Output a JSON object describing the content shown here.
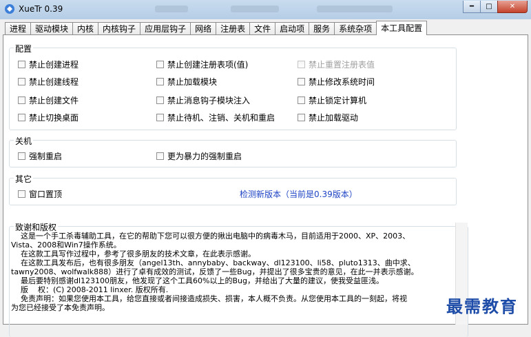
{
  "window": {
    "title": "XueTr 0.39"
  },
  "tabs": [
    "进程",
    "驱动模块",
    "内核",
    "内核钩子",
    "应用层钩子",
    "网络",
    "注册表",
    "文件",
    "启动项",
    "服务",
    "系统杂项",
    "本工具配置"
  ],
  "active_tab": 11,
  "config": {
    "label": "配置",
    "options": [
      {
        "label": "禁止创建进程",
        "enabled": true
      },
      {
        "label": "禁止创建注册表项(值)",
        "enabled": true
      },
      {
        "label": "禁止重置注册表值",
        "enabled": false
      },
      {
        "label": "禁止创建线程",
        "enabled": true
      },
      {
        "label": "禁止加载模块",
        "enabled": true
      },
      {
        "label": "禁止修改系统时间",
        "enabled": true
      },
      {
        "label": "禁止创建文件",
        "enabled": true
      },
      {
        "label": "禁止消息钩子模块注入",
        "enabled": true
      },
      {
        "label": "禁止锁定计算机",
        "enabled": true
      },
      {
        "label": "禁止切换桌面",
        "enabled": true
      },
      {
        "label": "禁止待机、注销、关机和重启",
        "enabled": true
      },
      {
        "label": "禁止加载驱动",
        "enabled": true
      }
    ]
  },
  "shutdown": {
    "label": "关机",
    "options": [
      {
        "label": "强制重启"
      },
      {
        "label": "更为暴力的强制重启"
      }
    ]
  },
  "other": {
    "label": "其它",
    "options": [
      {
        "label": "窗口置顶"
      }
    ],
    "check_update": "检测新版本（当前是0.39版本）"
  },
  "about": {
    "label": "致谢和版权",
    "lines": [
      "    这是一个手工杀毒辅助工具，在它的帮助下您可以很方便的揪出电脑中的病毒木马，目前适用于2000、XP、2003、",
      "Vista、2008和Win7操作系统。",
      "    在这款工具写作过程中，参考了很多朋友的技术文章，在此表示感谢。",
      "    在这款工具发布后，也有很多朋友（angel13th、annybaby、backway、dl123100、li58、pluto1313、曲中求、",
      "tawny2008、wolfwalk888）进行了卓有成效的测试，反馈了一些Bug，并提出了很多宝贵的意见，在此一并表示感谢。",
      "    最后要特别感谢dl123100朋友，他发现了这个工具60%以上的Bug，并给出了大量的建议，使我受益匪浅。",
      "",
      "    版    权：(C) 2008-2011 linxer. 版权所有.",
      "",
      "    免责声明：如果您使用本工具，给您直接或者间接造成损失、损害，本人概不负责。从您使用本工具的一刻起，将视",
      "为您已经接受了本免责声明。"
    ]
  },
  "watermark": "最需教育"
}
